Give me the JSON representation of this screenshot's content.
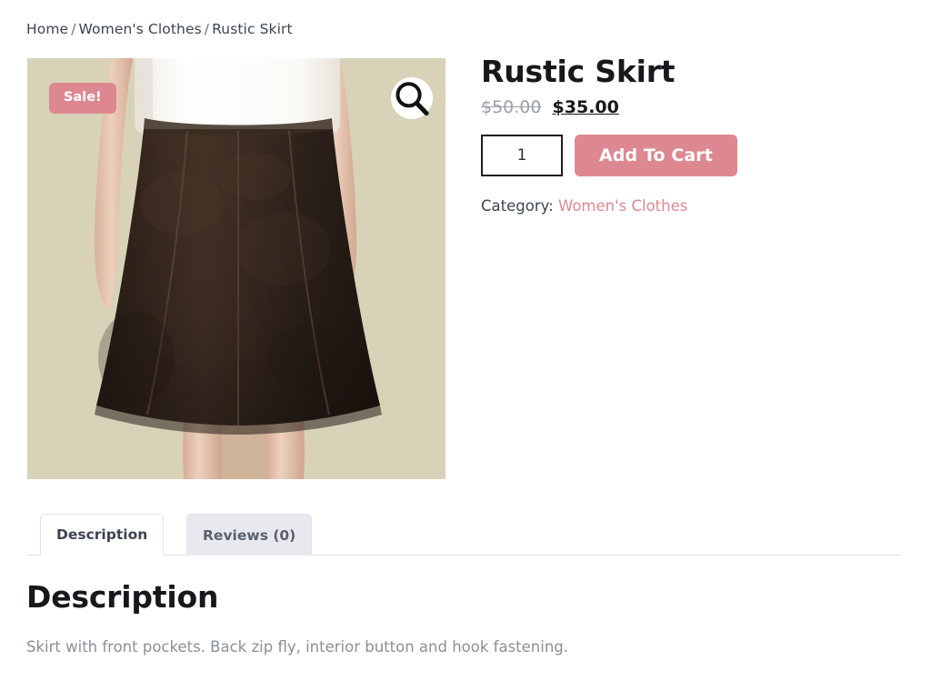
{
  "breadcrumb": {
    "items": [
      {
        "label": "Home",
        "interactable": true
      },
      {
        "label": "Women's Clothes",
        "interactable": true
      },
      {
        "label": "Rustic Skirt",
        "interactable": false
      }
    ],
    "separator": "/"
  },
  "gallery": {
    "sale_badge": "Sale!",
    "zoom_icon": "magnifier-icon",
    "image_alt": "Rustic Skirt product photo",
    "colors": {
      "background": "#d6cfb6",
      "skirt": "#2a1f1a",
      "skirt_highlight": "#453329",
      "top": "#fdfdfb",
      "skin": "#e7c8b4",
      "skin_shadow": "#d4ad97"
    }
  },
  "product": {
    "title": "Rustic Skirt",
    "price_old": "$50.00",
    "price_new": "$35.00",
    "quantity": "1",
    "quantity_placeholder": "1",
    "add_to_cart_label": "Add To Cart",
    "category_label": "Category:",
    "category_value": "Women's Clothes"
  },
  "tabs": [
    {
      "label": "Description",
      "active": true
    },
    {
      "label": "Reviews (0)",
      "active": false
    }
  ],
  "description": {
    "heading": "Description",
    "body": "Skirt with front pockets. Back zip fly, interior button and hook fastening."
  },
  "theme": {
    "accent": "#dd8891",
    "text": "#3d4451",
    "muted": "#8a8f99",
    "border": "#e2e2ea",
    "tab_inactive_bg": "#e8e8ee"
  }
}
